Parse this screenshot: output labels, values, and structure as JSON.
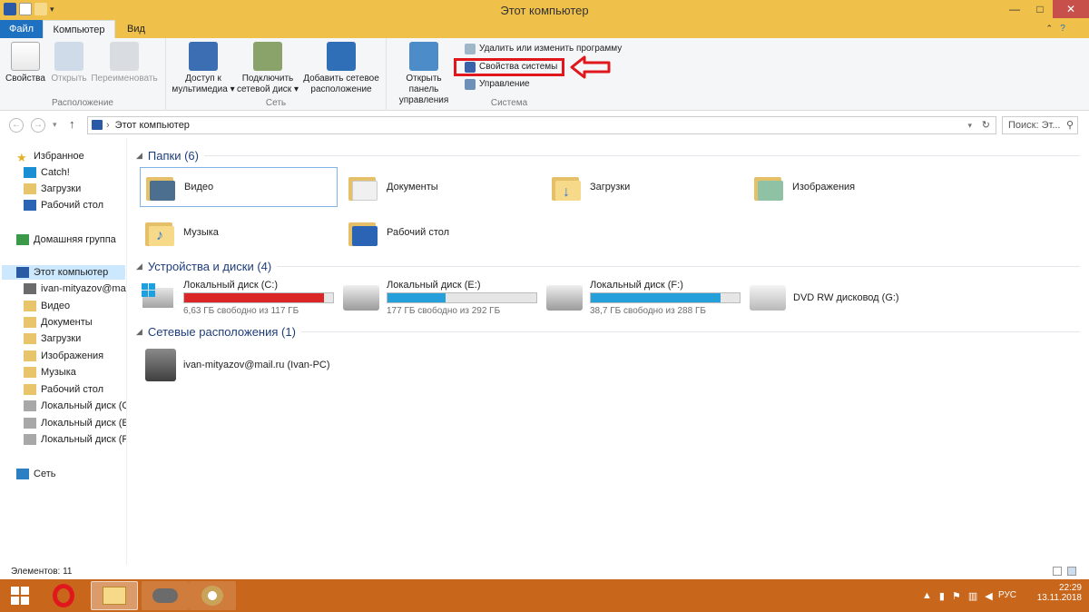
{
  "window": {
    "title": "Этот компьютер",
    "minimize": "—",
    "maximize": "□",
    "close": "✕",
    "help": "?"
  },
  "tabs": {
    "file": "Файл",
    "computer": "Компьютер",
    "view": "Вид"
  },
  "ribbon": {
    "location_group": {
      "label": "Расположение",
      "properties": "Свойства",
      "open": "Открыть",
      "rename": "Переименовать"
    },
    "network_group": {
      "label": "Сеть",
      "media_l1": "Доступ к",
      "media_l2": "мультимедиа",
      "map_l1": "Подключить",
      "map_l2": "сетевой диск",
      "add_l1": "Добавить сетевое",
      "add_l2": "расположение"
    },
    "system_group": {
      "label": "Система",
      "cp_l1": "Открыть панель",
      "cp_l2": "управления",
      "uninstall": "Удалить или изменить программу",
      "sysprops": "Свойства системы",
      "manage": "Управление"
    }
  },
  "address": {
    "path": "Этот компьютер",
    "search_placeholder": "Поиск: Эт..."
  },
  "nav": [
    {
      "label": "Избранное",
      "icon": "star-icon"
    },
    {
      "label": "Catch!",
      "icon": "lightning-icon"
    },
    {
      "label": "Загрузки",
      "icon": "folder-icon"
    },
    {
      "label": "Рабочий стол",
      "icon": "desktop-icon"
    },
    {
      "label": "Домашняя группа",
      "icon": "homegroup-icon"
    },
    {
      "label": "Этот компьютер",
      "icon": "computer-icon"
    },
    {
      "label": "ivan-mityazov@mai",
      "icon": "network-drive-icon"
    },
    {
      "label": "Видео",
      "icon": "folder-icon"
    },
    {
      "label": "Документы",
      "icon": "folder-icon"
    },
    {
      "label": "Загрузки",
      "icon": "folder-icon"
    },
    {
      "label": "Изображения",
      "icon": "folder-icon"
    },
    {
      "label": "Музыка",
      "icon": "folder-icon"
    },
    {
      "label": "Рабочий стол",
      "icon": "folder-icon"
    },
    {
      "label": "Локальный диск (C",
      "icon": "drive-icon"
    },
    {
      "label": "Локальный диск (E:",
      "icon": "drive-icon"
    },
    {
      "label": "Локальный диск (F:",
      "icon": "drive-icon"
    },
    {
      "label": "Сеть",
      "icon": "network-icon"
    }
  ],
  "sections": {
    "folders": "Папки (6)",
    "devices": "Устройства и диски (4)",
    "network": "Сетевые расположения (1)"
  },
  "folders": [
    "Видео",
    "Документы",
    "Загрузки",
    "Изображения",
    "Музыка",
    "Рабочий стол"
  ],
  "drives": [
    {
      "name": "Локальный диск (C:)",
      "free": "6,63 ГБ свободно из 117 ГБ",
      "used_fraction": 0.94,
      "color": "#da2626"
    },
    {
      "name": "Локальный диск (E:)",
      "free": "177 ГБ свободно из 292 ГБ",
      "used_fraction": 0.39,
      "color": "#26a0da"
    },
    {
      "name": "Локальный диск (F:)",
      "free": "38,7 ГБ свободно из 288 ГБ",
      "used_fraction": 0.87,
      "color": "#26a0da"
    },
    {
      "name": "DVD RW дисковод (G:)"
    }
  ],
  "network_location": "ivan-mityazov@mail.ru (Ivan-PC)",
  "status": "Элементов: 11",
  "tray": {
    "lang": "РУС",
    "time": "22:29",
    "date": "13.11.2018"
  }
}
